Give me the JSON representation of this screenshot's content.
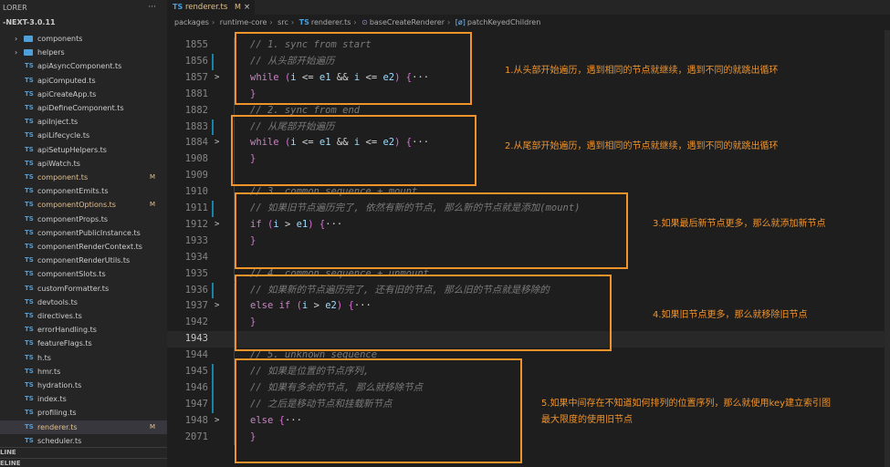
{
  "sidebar": {
    "header": "LORER",
    "more": "···",
    "project": "-NEXT-3.0.11",
    "items": [
      {
        "type": "folder",
        "label": "components"
      },
      {
        "type": "folder",
        "label": "helpers"
      },
      {
        "type": "ts",
        "label": "apiAsyncComponent.ts"
      },
      {
        "type": "ts",
        "label": "apiComputed.ts"
      },
      {
        "type": "ts",
        "label": "apiCreateApp.ts"
      },
      {
        "type": "ts",
        "label": "apiDefineComponent.ts"
      },
      {
        "type": "ts",
        "label": "apiInject.ts"
      },
      {
        "type": "ts",
        "label": "apiLifecycle.ts"
      },
      {
        "type": "ts",
        "label": "apiSetupHelpers.ts"
      },
      {
        "type": "ts",
        "label": "apiWatch.ts"
      },
      {
        "type": "ts",
        "label": "component.ts",
        "badge": "M"
      },
      {
        "type": "ts",
        "label": "componentEmits.ts"
      },
      {
        "type": "ts",
        "label": "componentOptions.ts",
        "badge": "M"
      },
      {
        "type": "ts",
        "label": "componentProps.ts"
      },
      {
        "type": "ts",
        "label": "componentPublicInstance.ts"
      },
      {
        "type": "ts",
        "label": "componentRenderContext.ts"
      },
      {
        "type": "ts",
        "label": "componentRenderUtils.ts"
      },
      {
        "type": "ts",
        "label": "componentSlots.ts"
      },
      {
        "type": "ts",
        "label": "customFormatter.ts"
      },
      {
        "type": "ts",
        "label": "devtools.ts"
      },
      {
        "type": "ts",
        "label": "directives.ts"
      },
      {
        "type": "ts",
        "label": "errorHandling.ts"
      },
      {
        "type": "ts",
        "label": "featureFlags.ts"
      },
      {
        "type": "ts",
        "label": "h.ts"
      },
      {
        "type": "ts",
        "label": "hmr.ts"
      },
      {
        "type": "ts",
        "label": "hydration.ts"
      },
      {
        "type": "ts",
        "label": "index.ts"
      },
      {
        "type": "ts",
        "label": "profiling.ts"
      },
      {
        "type": "ts",
        "label": "renderer.ts",
        "badge": "M",
        "selected": true
      },
      {
        "type": "ts",
        "label": "scheduler.ts"
      }
    ],
    "ts_icon": "TS",
    "outline_label": "LINE",
    "timeline_label": "ELINE"
  },
  "tab": {
    "icon": "TS",
    "name": "renderer.ts",
    "modified": "M",
    "close": "×"
  },
  "breadcrumb": {
    "parts": [
      "packages",
      "runtime-core",
      "src",
      "renderer.ts",
      "baseCreateRenderer",
      "patchKeyedChildren"
    ],
    "ts_icon": "TS",
    "fn_icon": "⊙",
    "var_icon": "[ø]"
  },
  "editor": {
    "lines": [
      {
        "n": "1855",
        "fold": "",
        "tokens": [
          [
            "cm-dim",
            "// 1. sync from start"
          ]
        ]
      },
      {
        "n": "1856",
        "fold": "",
        "git": true,
        "tokens": [
          [
            "cm-dim",
            "// 从头部开始遍历"
          ]
        ]
      },
      {
        "n": "1857",
        "fold": ">",
        "tokens": [
          [
            "kw",
            "while"
          ],
          [
            "op",
            " "
          ],
          [
            "br1",
            "("
          ],
          [
            "var",
            "i"
          ],
          [
            "op",
            " <= "
          ],
          [
            "var",
            "e1"
          ],
          [
            "op",
            " && "
          ],
          [
            "var",
            "i"
          ],
          [
            "op",
            " <= "
          ],
          [
            "var",
            "e2"
          ],
          [
            "br1",
            ")"
          ],
          [
            "op",
            " "
          ],
          [
            "br1",
            "{"
          ],
          [
            "fold",
            "···"
          ]
        ]
      },
      {
        "n": "1881",
        "fold": "",
        "tokens": [
          [
            "br1",
            "}"
          ]
        ]
      },
      {
        "n": "1882",
        "fold": "",
        "tokens": [
          [
            "cm-dim",
            "// 2. sync from end"
          ]
        ]
      },
      {
        "n": "1883",
        "fold": "",
        "git": true,
        "tokens": [
          [
            "cm-dim",
            "// 从尾部开始遍历"
          ]
        ]
      },
      {
        "n": "1884",
        "fold": ">",
        "tokens": [
          [
            "kw",
            "while"
          ],
          [
            "op",
            " "
          ],
          [
            "br1",
            "("
          ],
          [
            "var",
            "i"
          ],
          [
            "op",
            " <= "
          ],
          [
            "var",
            "e1"
          ],
          [
            "op",
            " && "
          ],
          [
            "var",
            "i"
          ],
          [
            "op",
            " <= "
          ],
          [
            "var",
            "e2"
          ],
          [
            "br1",
            ")"
          ],
          [
            "op",
            " "
          ],
          [
            "br1",
            "{"
          ],
          [
            "fold",
            "···"
          ]
        ]
      },
      {
        "n": "1908",
        "fold": "",
        "tokens": [
          [
            "br1",
            "}"
          ]
        ]
      },
      {
        "n": "1909",
        "fold": "",
        "tokens": []
      },
      {
        "n": "1910",
        "fold": "",
        "tokens": [
          [
            "cm-dim",
            "// 3. common sequence + mount"
          ]
        ]
      },
      {
        "n": "1911",
        "fold": "",
        "git": true,
        "tokens": [
          [
            "cm-dim",
            "// 如果旧节点遍历完了, 依然有新的节点, 那么新的节点就是添加(mount)"
          ]
        ]
      },
      {
        "n": "1912",
        "fold": ">",
        "tokens": [
          [
            "kw",
            "if"
          ],
          [
            "op",
            " "
          ],
          [
            "br1",
            "("
          ],
          [
            "var",
            "i"
          ],
          [
            "op",
            " > "
          ],
          [
            "var",
            "e1"
          ],
          [
            "br1",
            ")"
          ],
          [
            "op",
            " "
          ],
          [
            "br1",
            "{"
          ],
          [
            "fold",
            "···"
          ]
        ]
      },
      {
        "n": "1933",
        "fold": "",
        "tokens": [
          [
            "br1",
            "}"
          ]
        ]
      },
      {
        "n": "1934",
        "fold": "",
        "tokens": []
      },
      {
        "n": "1935",
        "fold": "",
        "tokens": [
          [
            "cm-dim",
            "// 4. common sequence + unmount"
          ]
        ]
      },
      {
        "n": "1936",
        "fold": "",
        "git": true,
        "tokens": [
          [
            "cm-dim",
            "// 如果新的节点遍历完了, 还有旧的节点, 那么旧的节点就是移除的"
          ]
        ]
      },
      {
        "n": "1937",
        "fold": ">",
        "tokens": [
          [
            "kw",
            "else if"
          ],
          [
            "op",
            " "
          ],
          [
            "br1",
            "("
          ],
          [
            "var",
            "i"
          ],
          [
            "op",
            " > "
          ],
          [
            "var",
            "e2"
          ],
          [
            "br1",
            ")"
          ],
          [
            "op",
            " "
          ],
          [
            "br1",
            "{"
          ],
          [
            "fold",
            "···"
          ]
        ]
      },
      {
        "n": "1942",
        "fold": "",
        "tokens": [
          [
            "br1",
            "}"
          ]
        ]
      },
      {
        "n": "1943",
        "fold": "",
        "cur": true,
        "tokens": []
      },
      {
        "n": "1944",
        "fold": "",
        "tokens": [
          [
            "cm-dim",
            "// 5. unknown sequence"
          ]
        ]
      },
      {
        "n": "1945",
        "fold": "",
        "git": true,
        "tokens": [
          [
            "cm-dim",
            "// 如果是位置的节点序列,"
          ]
        ]
      },
      {
        "n": "1946",
        "fold": "",
        "git": true,
        "tokens": [
          [
            "cm-dim",
            "// 如果有多余的节点, 那么就移除节点"
          ]
        ]
      },
      {
        "n": "1947",
        "fold": "",
        "git": true,
        "tokens": [
          [
            "cm-dim",
            "// 之后是移动节点和挂载新节点"
          ]
        ]
      },
      {
        "n": "1948",
        "fold": ">",
        "tokens": [
          [
            "kw",
            "else"
          ],
          [
            "op",
            " "
          ],
          [
            "br1",
            "{"
          ],
          [
            "fold",
            "···"
          ]
        ]
      },
      {
        "n": "2071",
        "fold": "",
        "tokens": [
          [
            "br1",
            "}"
          ]
        ]
      }
    ]
  },
  "annotations": [
    {
      "text": "1.从头部开始遍历，遇到相同的节点就继续，遇到不同的就跳出循环"
    },
    {
      "text": "2.从尾部开始遍历，遇到相同的节点就继续，遇到不同的就跳出循环"
    },
    {
      "text": "3.如果最后新节点更多，那么就添加新节点"
    },
    {
      "text": "4.如果旧节点更多，那么就移除旧节点"
    },
    {
      "text": "5.如果中间存在不知道如何排列的位置序列，那么就使用key建立索引图",
      "text2": "最大限度的使用旧节点"
    }
  ],
  "colors": {
    "annotation": "#f0932b",
    "modified": "#e2c08d",
    "ts_icon": "#4a9fdc"
  }
}
